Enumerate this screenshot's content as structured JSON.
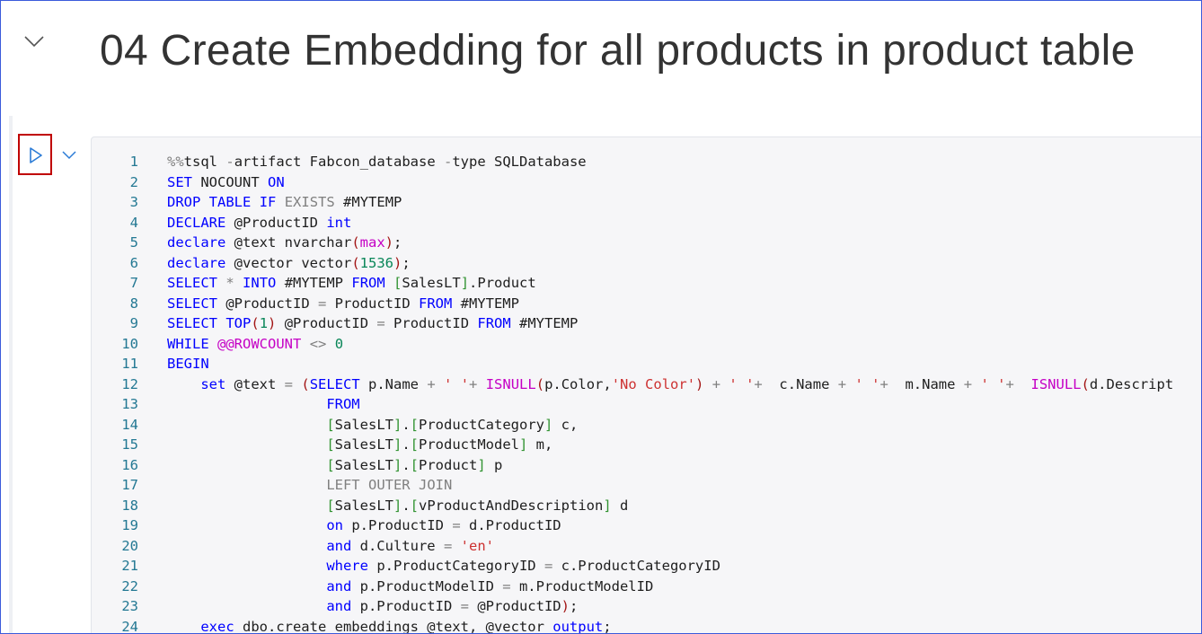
{
  "markdown_cell": {
    "title": "04 Create Embedding for all products in product table"
  },
  "code_cell": {
    "run_button_icon": "play-icon",
    "collapse_icon": "chevron-down-icon",
    "lines": [
      {
        "n": "1",
        "text": "%%tsql -artifact Fabcon_database -type SQLDatabase"
      },
      {
        "n": "2",
        "text": "SET NOCOUNT ON"
      },
      {
        "n": "3",
        "text": "DROP TABLE IF EXISTS #MYTEMP"
      },
      {
        "n": "4",
        "text": "DECLARE @ProductID int"
      },
      {
        "n": "5",
        "text": "declare @text nvarchar(max);"
      },
      {
        "n": "6",
        "text": "declare @vector vector(1536);"
      },
      {
        "n": "7",
        "text": "SELECT * INTO #MYTEMP FROM [SalesLT].Product"
      },
      {
        "n": "8",
        "text": "SELECT @ProductID = ProductID FROM #MYTEMP"
      },
      {
        "n": "9",
        "text": "SELECT TOP(1) @ProductID = ProductID FROM #MYTEMP"
      },
      {
        "n": "10",
        "text": "WHILE @@ROWCOUNT <> 0"
      },
      {
        "n": "11",
        "text": "BEGIN"
      },
      {
        "n": "12",
        "text": "    set @text = (SELECT p.Name + ' '+ ISNULL(p.Color,'No Color') + ' '+  c.Name + ' '+  m.Name + ' '+  ISNULL(d.Descript"
      },
      {
        "n": "13",
        "text": "                   FROM"
      },
      {
        "n": "14",
        "text": "                   [SalesLT].[ProductCategory] c,"
      },
      {
        "n": "15",
        "text": "                   [SalesLT].[ProductModel] m,"
      },
      {
        "n": "16",
        "text": "                   [SalesLT].[Product] p"
      },
      {
        "n": "17",
        "text": "                   LEFT OUTER JOIN"
      },
      {
        "n": "18",
        "text": "                   [SalesLT].[vProductAndDescription] d"
      },
      {
        "n": "19",
        "text": "                   on p.ProductID = d.ProductID"
      },
      {
        "n": "20",
        "text": "                   and d.Culture = 'en'"
      },
      {
        "n": "21",
        "text": "                   where p.ProductCategoryID = c.ProductCategoryID"
      },
      {
        "n": "22",
        "text": "                   and p.ProductModelID = m.ProductModelID"
      },
      {
        "n": "23",
        "text": "                   and p.ProductID = @ProductID);"
      },
      {
        "n": "24",
        "text": "    exec dbo.create_embeddings @text, @vector output;"
      }
    ]
  },
  "colors": {
    "keyword": "#0000ff",
    "muted_keyword": "#808080",
    "function": "#a31515",
    "string": "#cd3131",
    "system_var": "#c500c5",
    "number": "#098658",
    "bracket": "#319331",
    "line_number": "#237893",
    "run_highlight_border": "#c00000"
  }
}
